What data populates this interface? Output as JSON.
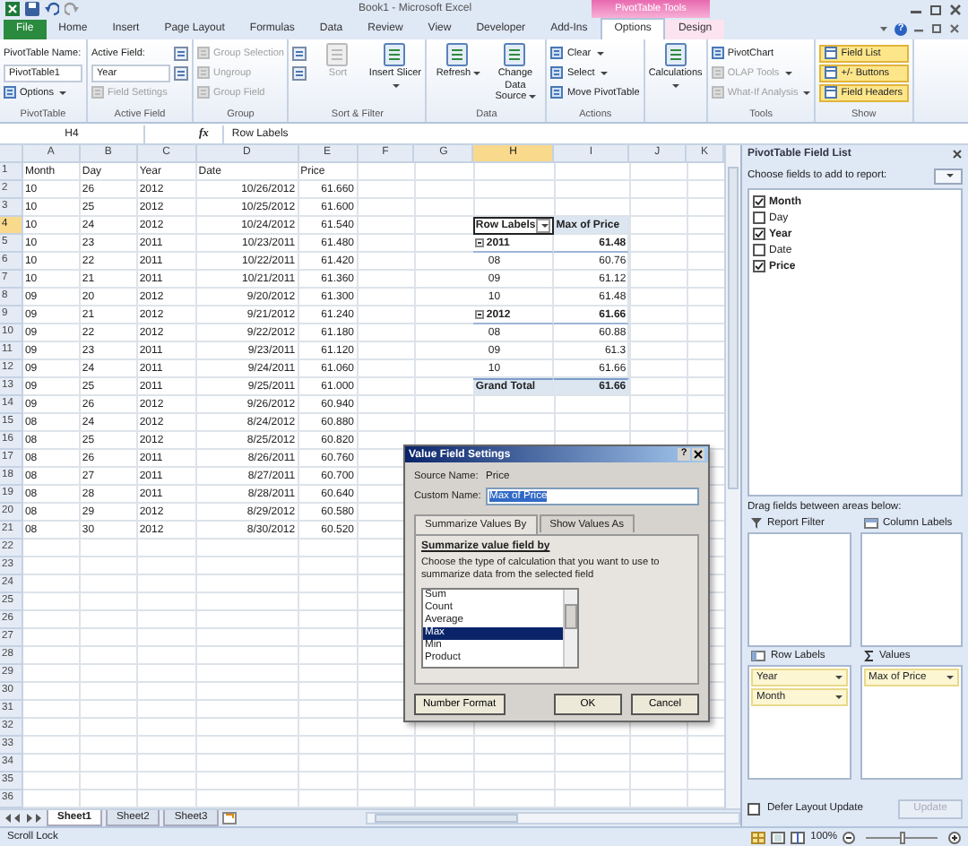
{
  "title_bar": {
    "title": "Book1 - Microsoft Excel",
    "context_tab": "PivotTable Tools",
    "help": "?"
  },
  "tabs": [
    {
      "label": "File",
      "kind": "file",
      "context": false,
      "selected": false
    },
    {
      "label": "Home",
      "kind": "tab",
      "context": false,
      "selected": false
    },
    {
      "label": "Insert",
      "kind": "tab",
      "context": false,
      "selected": false
    },
    {
      "label": "Page Layout",
      "kind": "tab",
      "context": false,
      "selected": false
    },
    {
      "label": "Formulas",
      "kind": "tab",
      "context": false,
      "selected": false
    },
    {
      "label": "Data",
      "kind": "tab",
      "context": false,
      "selected": false
    },
    {
      "label": "Review",
      "kind": "tab",
      "context": false,
      "selected": false
    },
    {
      "label": "View",
      "kind": "tab",
      "context": false,
      "selected": false
    },
    {
      "label": "Developer",
      "kind": "tab",
      "context": false,
      "selected": false
    },
    {
      "label": "Add-Ins",
      "kind": "tab",
      "context": false,
      "selected": false
    },
    {
      "label": "Options",
      "kind": "tab",
      "context": true,
      "selected": true
    },
    {
      "label": "Design",
      "kind": "tab",
      "context": true,
      "selected": false
    }
  ],
  "ribbon": [
    {
      "label": "PivotTable",
      "items": [
        {
          "kind": "caption",
          "label": "PivotTable Name:"
        },
        {
          "kind": "field",
          "value": "PivotTable1"
        },
        {
          "kind": "small",
          "label": "Options",
          "dropdown": true,
          "disabled": false
        }
      ]
    },
    {
      "label": "Active Field",
      "items": [
        {
          "kind": "caption",
          "label": "Active Field:"
        },
        {
          "kind": "field",
          "value": "Year"
        },
        {
          "kind": "small",
          "label": "Field Settings",
          "dropdown": false,
          "disabled": true
        },
        {
          "kind": "icon"
        },
        {
          "kind": "icon"
        }
      ]
    },
    {
      "label": "Group",
      "items": [
        {
          "kind": "small",
          "label": "Group Selection",
          "dropdown": false,
          "disabled": true
        },
        {
          "kind": "small",
          "label": "Ungroup",
          "dropdown": false,
          "disabled": true
        },
        {
          "kind": "small",
          "label": "Group Field",
          "dropdown": false,
          "disabled": true
        }
      ]
    },
    {
      "label": "Sort & Filter",
      "items": [
        {
          "kind": "icon"
        },
        {
          "kind": "icon"
        },
        {
          "kind": "large",
          "label": "Sort",
          "dropdown": false,
          "disabled": true
        },
        {
          "kind": "large",
          "label": "Insert Slicer",
          "dropdown": true,
          "disabled": false
        }
      ]
    },
    {
      "label": "Data",
      "items": [
        {
          "kind": "large",
          "label": "Refresh",
          "dropdown": true,
          "disabled": false
        },
        {
          "kind": "large",
          "label": "Change Data Source",
          "dropdown": true,
          "disabled": false
        }
      ]
    },
    {
      "label": "Actions",
      "items": [
        {
          "kind": "small",
          "label": "Clear",
          "dropdown": true,
          "disabled": false
        },
        {
          "kind": "small",
          "label": "Select",
          "dropdown": true,
          "disabled": false
        },
        {
          "kind": "small",
          "label": "Move PivotTable",
          "dropdown": false,
          "disabled": false
        }
      ]
    },
    {
      "items": [
        {
          "kind": "large",
          "label": "Calculations",
          "dropdown": true,
          "disabled": false
        }
      ]
    },
    {
      "label": "Tools",
      "items": [
        {
          "kind": "small",
          "label": "PivotChart",
          "dropdown": false,
          "disabled": false
        },
        {
          "kind": "small",
          "label": "OLAP Tools",
          "dropdown": true,
          "disabled": true
        },
        {
          "kind": "small",
          "label": "What-If Analysis",
          "dropdown": true,
          "disabled": true
        }
      ]
    },
    {
      "label": "Show",
      "items": [
        {
          "kind": "toggle",
          "label": "Field List",
          "on": true
        },
        {
          "kind": "toggle",
          "label": "+/- Buttons",
          "on": true
        },
        {
          "kind": "toggle",
          "label": "Field Headers",
          "on": true
        }
      ]
    }
  ],
  "formula_bar": {
    "name_box": "H4",
    "fx": "fx",
    "value": "Row Labels"
  },
  "sheet": {
    "columns": [
      {
        "label": "A",
        "selected": false
      },
      {
        "label": "B",
        "selected": false
      },
      {
        "label": "C",
        "selected": false
      },
      {
        "label": "D",
        "selected": false
      },
      {
        "label": "E",
        "selected": false
      },
      {
        "label": "F",
        "selected": false
      },
      {
        "label": "G",
        "selected": false
      },
      {
        "label": "H",
        "selected": true
      },
      {
        "label": "I",
        "selected": false
      },
      {
        "label": "J",
        "selected": false
      },
      {
        "label": "K",
        "selected": false
      }
    ],
    "rows": [
      {
        "number": "1",
        "selected": false,
        "cells": [
          "Month",
          "Day",
          "Year",
          "Date",
          "Price"
        ]
      },
      {
        "number": "2",
        "selected": false,
        "cells": [
          "10",
          "26",
          "2012",
          "10/26/2012",
          "61.660"
        ]
      },
      {
        "number": "3",
        "selected": false,
        "cells": [
          "10",
          "25",
          "2012",
          "10/25/2012",
          "61.600"
        ]
      },
      {
        "number": "4",
        "selected": true,
        "cells": [
          "10",
          "24",
          "2012",
          "10/24/2012",
          "61.540"
        ]
      },
      {
        "number": "5",
        "selected": false,
        "cells": [
          "10",
          "23",
          "2011",
          "10/23/2011",
          "61.480"
        ]
      },
      {
        "number": "6",
        "selected": false,
        "cells": [
          "10",
          "22",
          "2011",
          "10/22/2011",
          "61.420"
        ]
      },
      {
        "number": "7",
        "selected": false,
        "cells": [
          "10",
          "21",
          "2011",
          "10/21/2011",
          "61.360"
        ]
      },
      {
        "number": "8",
        "selected": false,
        "cells": [
          "09",
          "20",
          "2012",
          "9/20/2012",
          "61.300"
        ]
      },
      {
        "number": "9",
        "selected": false,
        "cells": [
          "09",
          "21",
          "2012",
          "9/21/2012",
          "61.240"
        ]
      },
      {
        "number": "10",
        "selected": false,
        "cells": [
          "09",
          "22",
          "2012",
          "9/22/2012",
          "61.180"
        ]
      },
      {
        "number": "11",
        "selected": false,
        "cells": [
          "09",
          "23",
          "2011",
          "9/23/2011",
          "61.120"
        ]
      },
      {
        "number": "12",
        "selected": false,
        "cells": [
          "09",
          "24",
          "2011",
          "9/24/2011",
          "61.060"
        ]
      },
      {
        "number": "13",
        "selected": false,
        "cells": [
          "09",
          "25",
          "2011",
          "9/25/2011",
          "61.000"
        ]
      },
      {
        "number": "14",
        "selected": false,
        "cells": [
          "09",
          "26",
          "2012",
          "9/26/2012",
          "60.940"
        ]
      },
      {
        "number": "15",
        "selected": false,
        "cells": [
          "08",
          "24",
          "2012",
          "8/24/2012",
          "60.880"
        ]
      },
      {
        "number": "16",
        "selected": false,
        "cells": [
          "08",
          "25",
          "2012",
          "8/25/2012",
          "60.820"
        ]
      },
      {
        "number": "17",
        "selected": false,
        "cells": [
          "08",
          "26",
          "2011",
          "8/26/2011",
          "60.760"
        ]
      },
      {
        "number": "18",
        "selected": false,
        "cells": [
          "08",
          "27",
          "2011",
          "8/27/2011",
          "60.700"
        ]
      },
      {
        "number": "19",
        "selected": false,
        "cells": [
          "08",
          "28",
          "2011",
          "8/28/2011",
          "60.640"
        ]
      },
      {
        "number": "20",
        "selected": false,
        "cells": [
          "08",
          "29",
          "2012",
          "8/29/2012",
          "60.580"
        ]
      },
      {
        "number": "21",
        "selected": false,
        "cells": [
          "08",
          "30",
          "2012",
          "8/30/2012",
          "60.520"
        ]
      },
      {
        "number": "22",
        "selected": false
      },
      {
        "number": "23",
        "selected": false
      },
      {
        "number": "24",
        "selected": false
      },
      {
        "number": "25",
        "selected": false
      },
      {
        "number": "26",
        "selected": false
      },
      {
        "number": "27",
        "selected": false
      },
      {
        "number": "28",
        "selected": false
      },
      {
        "number": "29",
        "selected": false
      },
      {
        "number": "30",
        "selected": false
      },
      {
        "number": "31",
        "selected": false
      },
      {
        "number": "32",
        "selected": false
      },
      {
        "number": "33",
        "selected": false
      },
      {
        "number": "34",
        "selected": false
      },
      {
        "number": "35",
        "selected": false
      },
      {
        "number": "36",
        "selected": false
      }
    ]
  },
  "pivot": {
    "header": [
      "Row Labels",
      "Max of Price"
    ],
    "rows": [
      {
        "kind": "year",
        "label": "2011",
        "value": "61.48",
        "expanded": true
      },
      {
        "kind": "month",
        "label": "08",
        "value": "60.76"
      },
      {
        "kind": "month",
        "label": "09",
        "value": "61.12"
      },
      {
        "kind": "month",
        "label": "10",
        "value": "61.48"
      },
      {
        "kind": "year",
        "label": "2012",
        "value": "61.66",
        "expanded": true
      },
      {
        "kind": "month",
        "label": "08",
        "value": "60.88"
      },
      {
        "kind": "month",
        "label": "09",
        "value": "61.3"
      },
      {
        "kind": "month",
        "label": "10",
        "value": "61.66"
      },
      {
        "kind": "total",
        "label": "Grand Total",
        "value": "61.66"
      }
    ]
  },
  "sheet_tabs": [
    {
      "label": "Sheet1",
      "selected": true
    },
    {
      "label": "Sheet2",
      "selected": false
    },
    {
      "label": "Sheet3",
      "selected": false
    }
  ],
  "dialog": {
    "title": "Value Field Settings",
    "help": "?",
    "source_label": "Source Name:",
    "source_value": "Price",
    "custom_label": "Custom Name:",
    "custom_value": "Max of Price",
    "tabs": [
      {
        "label": "Summarize Values By",
        "selected": true
      },
      {
        "label": "Show Values As",
        "selected": false
      }
    ],
    "section_title": "Summarize value field by",
    "description": "Choose the type of calculation that you want to use to summarize data from the selected field",
    "options": [
      {
        "label": "Sum",
        "selected": false
      },
      {
        "label": "Count",
        "selected": false
      },
      {
        "label": "Average",
        "selected": false
      },
      {
        "label": "Max",
        "selected": true
      },
      {
        "label": "Min",
        "selected": false
      },
      {
        "label": "Product",
        "selected": false
      }
    ],
    "buttons": [
      {
        "label": "Number Format",
        "kind": "left"
      },
      {
        "label": "OK",
        "kind": "right"
      },
      {
        "label": "Cancel",
        "kind": "right"
      }
    ]
  },
  "field_list": {
    "title": "PivotTable Field List",
    "prompt": "Choose fields to add to report:",
    "fields": [
      {
        "label": "Month",
        "checked": true
      },
      {
        "label": "Day",
        "checked": false
      },
      {
        "label": "Year",
        "checked": true
      },
      {
        "label": "Date",
        "checked": false
      },
      {
        "label": "Price",
        "checked": true
      }
    ],
    "drag_hint": "Drag fields between areas below:",
    "areas": [
      {
        "kind": "filter",
        "label": "Report Filter"
      },
      {
        "kind": "columns",
        "label": "Column Labels"
      },
      {
        "kind": "rows",
        "label": "Row Labels",
        "items": [
          "Year",
          "Month"
        ]
      },
      {
        "kind": "values",
        "label": "Values",
        "items": [
          "Max of Price"
        ]
      }
    ],
    "defer": {
      "label": "Defer Layout Update",
      "checked": false
    },
    "update": {
      "label": "Update",
      "disabled": true
    }
  },
  "status_bar": {
    "mode": "Scroll Lock",
    "zoom": "100%",
    "zoom_slider": {
      "level": 0.5
    }
  }
}
